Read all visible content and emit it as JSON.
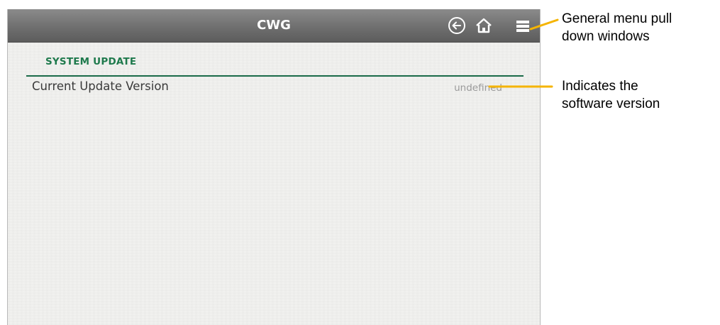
{
  "app": {
    "title": "CWG"
  },
  "toolbar": {
    "back_icon": "back-arrow-circle-icon",
    "home_icon": "home-icon",
    "menu_icon": "menu-icon"
  },
  "section": {
    "title": "SYSTEM UPDATE"
  },
  "rows": [
    {
      "label": "Current Update Version",
      "value": "undefined"
    }
  ],
  "annotations": {
    "menu_note": "General menu pull down windows",
    "menu_note_line1": "General menu pull",
    "menu_note_line2": "down windows",
    "version_note_line1": "Indicates the",
    "version_note_line2": "software version"
  },
  "colors": {
    "accent_green": "#1f7a4d",
    "callout_arrow": "#f5b400",
    "titlebar": "#707070"
  }
}
